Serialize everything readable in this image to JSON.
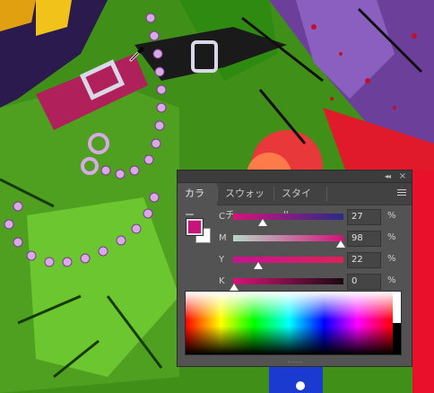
{
  "panel": {
    "tabs": [
      {
        "label": "カラー",
        "active": true
      },
      {
        "label": "スウォッチ",
        "active": false
      },
      {
        "label": "スタイル",
        "active": false
      }
    ],
    "collapse_glyph": "◂◂",
    "close_glyph": "×",
    "foreground_color": "#c8137a",
    "background_color": "#ffffff",
    "sliders": [
      {
        "label": "C",
        "value": "27",
        "unit": "%"
      },
      {
        "label": "M",
        "value": "98",
        "unit": "%"
      },
      {
        "label": "Y",
        "value": "22",
        "unit": "%"
      },
      {
        "label": "K",
        "value": "0",
        "unit": "%"
      }
    ],
    "icons": [
      "eyedropper-icon",
      "panel-menu-icon",
      "collapse-icon",
      "close-icon"
    ]
  }
}
